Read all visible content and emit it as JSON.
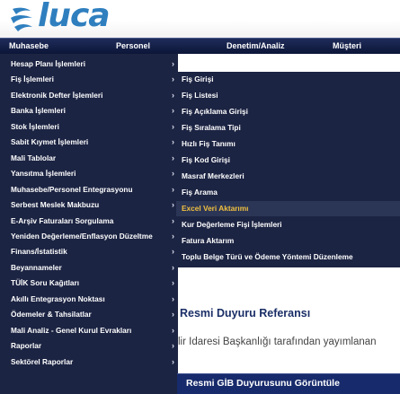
{
  "logo": {
    "text": "luca"
  },
  "top_nav": {
    "items": [
      "Muhasebe",
      "Personel",
      "Denetim/Analiz",
      "Müşteri"
    ]
  },
  "left_menu": {
    "items": [
      {
        "label": "Hesap Planı İşlemleri",
        "has_submenu": true
      },
      {
        "label": "Fiş İşlemleri",
        "has_submenu": true
      },
      {
        "label": "Elektronik Defter İşlemleri",
        "has_submenu": true
      },
      {
        "label": "Banka İşlemleri",
        "has_submenu": true
      },
      {
        "label": "Stok İşlemleri",
        "has_submenu": true
      },
      {
        "label": "Sabit Kıymet İşlemleri",
        "has_submenu": true
      },
      {
        "label": "Mali Tablolar",
        "has_submenu": true
      },
      {
        "label": "Yansıtma İşlemleri",
        "has_submenu": true
      },
      {
        "label": "Muhasebe/Personel Entegrasyonu",
        "has_submenu": true
      },
      {
        "label": "Serbest Meslek Makbuzu",
        "has_submenu": true
      },
      {
        "label": "E-Arşiv Faturaları Sorgulama",
        "has_submenu": true
      },
      {
        "label": "Yeniden Değerleme/Enflasyon Düzeltme",
        "has_submenu": true
      },
      {
        "label": "Finans/İstatistik",
        "has_submenu": true
      },
      {
        "label": "Beyannameler",
        "has_submenu": true
      },
      {
        "label": "TÜİK Soru Kağıtları",
        "has_submenu": true
      },
      {
        "label": "Akıllı Entegrasyon Noktası",
        "has_submenu": true
      },
      {
        "label": "Ödemeler & Tahsilatlar",
        "has_submenu": true
      },
      {
        "label": "Mali Analiz - Genel Kurul Evrakları",
        "has_submenu": true
      },
      {
        "label": "Raporlar",
        "has_submenu": true
      },
      {
        "label": "Sektörel Raporlar",
        "has_submenu": true
      }
    ],
    "chevron": "›"
  },
  "sub_menu": {
    "items": [
      {
        "label": "Fiş Girişi",
        "active": false
      },
      {
        "label": "Fiş Listesi",
        "active": false
      },
      {
        "label": "Fiş Açıklama Girişi",
        "active": false
      },
      {
        "label": "Fiş Sıralama Tipi",
        "active": false
      },
      {
        "label": "Hızlı Fiş Tanımı",
        "active": false
      },
      {
        "label": "Fiş Kod Girişi",
        "active": false
      },
      {
        "label": "Masraf Merkezleri",
        "active": false
      },
      {
        "label": "Fiş Arama",
        "active": false
      },
      {
        "label": "Excel Veri Aktarımı",
        "active": true
      },
      {
        "label": "Kur Değerleme Fişi İşlemleri",
        "active": false
      },
      {
        "label": "Fatura Aktarım",
        "active": false
      },
      {
        "label": "Toplu Belge Türü ve Ödeme Yöntemi Düzenleme",
        "active": false
      }
    ]
  },
  "content": {
    "heading": "Resmi Duyuru Referansı",
    "text": "lir İdaresi Başkanlığı tarafından yayımlanan",
    "gib_bar_label": "Resmi GİB Duyurusunu Görüntüle"
  },
  "colors": {
    "menu_bg": "#1c2443",
    "nav_bg": "#0c1638",
    "active_text": "#f0c040",
    "logo": "#2f7fbf",
    "heading": "#1a2e66",
    "gib_bar": "#172a6b"
  }
}
